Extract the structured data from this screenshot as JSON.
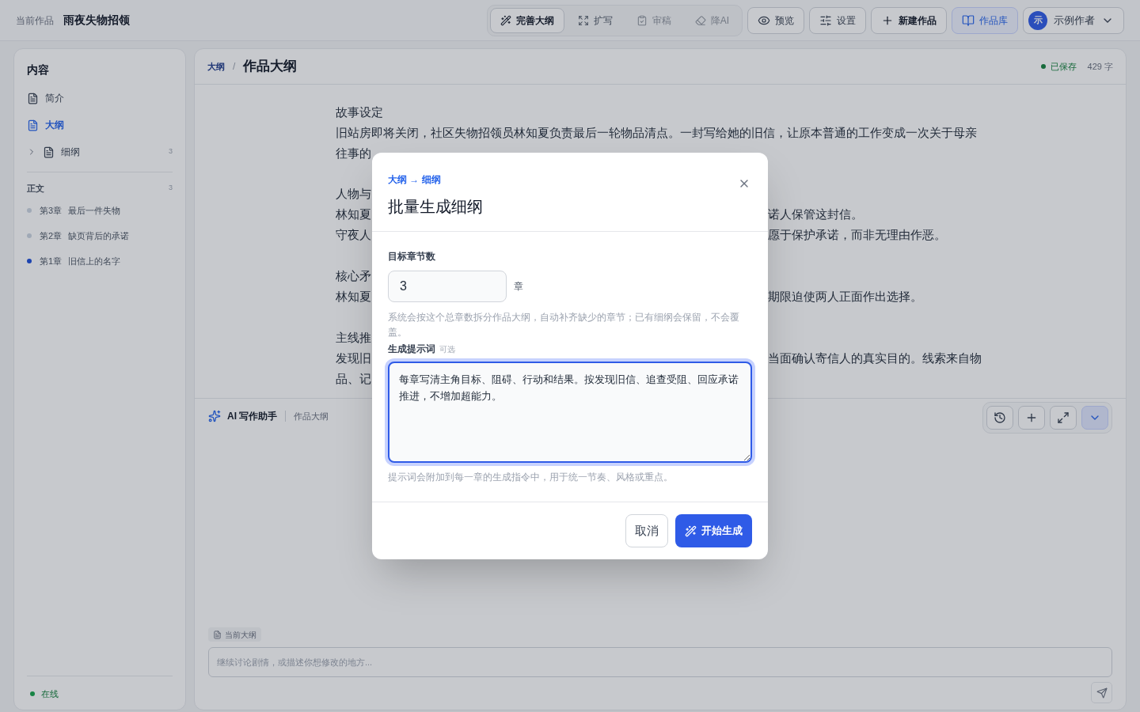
{
  "topbar": {
    "work_label": "当前作品",
    "work_title": "雨夜失物招领",
    "tools": [
      {
        "kind": "wand",
        "label": "完善大纲",
        "selected": true,
        "disabled": false
      },
      {
        "kind": "expand",
        "label": "扩写",
        "selected": false,
        "disabled": false
      },
      {
        "kind": "clipboard",
        "label": "审稿",
        "selected": false,
        "disabled": true
      },
      {
        "kind": "eraser",
        "label": "降AI",
        "selected": false,
        "disabled": true
      }
    ],
    "actions": [
      {
        "kind": "eye",
        "label": "预览"
      },
      {
        "kind": "sliders",
        "label": "设置"
      },
      {
        "kind": "plus",
        "label": "新建作品"
      },
      {
        "kind": "book",
        "label": "作品库"
      }
    ],
    "user": {
      "avatar": "示",
      "name": "示例作者"
    }
  },
  "sidebar": {
    "title": "内容",
    "items": [
      {
        "label": "简介",
        "selected": false
      },
      {
        "label": "大纲",
        "selected": true
      },
      {
        "label": "细纲",
        "selected": false,
        "expanded": false,
        "count": "3"
      }
    ],
    "section": {
      "title": "正文",
      "count": "3"
    },
    "chapters": [
      {
        "number": "第3章",
        "title": "最后一件失物",
        "selected": false
      },
      {
        "number": "第2章",
        "title": "缺页背后的承诺",
        "selected": false
      },
      {
        "number": "第1章",
        "title": "旧信上的名字",
        "selected": true
      }
    ],
    "status": "在线"
  },
  "editor": {
    "breadcrumb": "大纲",
    "separator": "/",
    "title": "作品大纲",
    "saved": "已保存",
    "word_count": "429 字",
    "paragraphs": [
      {
        "lines": [
          {
            "text": "故事设定"
          },
          {
            "text": "旧站房即将关闭，社区失物招领员林知夏负责最后一轮物品清点。一封写给她的旧信，让原本普通的工作变成一次关于母亲"
          },
          {
            "text": "往事的"
          }
        ]
      },
      {
        "lines": [
          {
            "left": "人物与"
          },
          {
            "left": "林知夏",
            "right": "诺人保管这封信。"
          },
          {
            "left": "守夜人",
            "right": "愿于保护承诺，而非无理由作恶。"
          }
        ]
      },
      {
        "lines": [
          {
            "left": "核心矛"
          },
          {
            "left": "林知夏",
            "right": "期限迫使两人正面作出选择。"
          }
        ]
      },
      {
        "lines": [
          {
            "left": "主线推"
          },
          {
            "left": "发现旧",
            "right": "当面确认寄信人的真实目的。线索来自物"
          },
          {
            "left": "品、记"
          }
        ]
      }
    ]
  },
  "assistant": {
    "title": "AI 写作助手",
    "context": "作品大纲",
    "chip": "当前大纲",
    "placeholder": "继续讨论剧情，或描述你想修改的地方..."
  },
  "dialog": {
    "path": "大纲 → 细纲",
    "title": "批量生成细纲",
    "count_label": "目标章节数",
    "count_value": "3",
    "count_unit": "章",
    "count_help": "系统会按这个总章数拆分作品大纲，自动补齐缺少的章节；已有细纲会保留，不会覆盖。",
    "prompt_label": "生成提示词",
    "prompt_optional": "可选",
    "prompt_value": "每章写清主角目标、阻碍、行动和结果。按发现旧信、追查受阻、回应承诺推进，不增加超能力。",
    "prompt_help": "提示词会附加到每一章的生成指令中，用于统一节奏、风格或重点。",
    "cancel": "取消",
    "confirm": "开始生成"
  }
}
